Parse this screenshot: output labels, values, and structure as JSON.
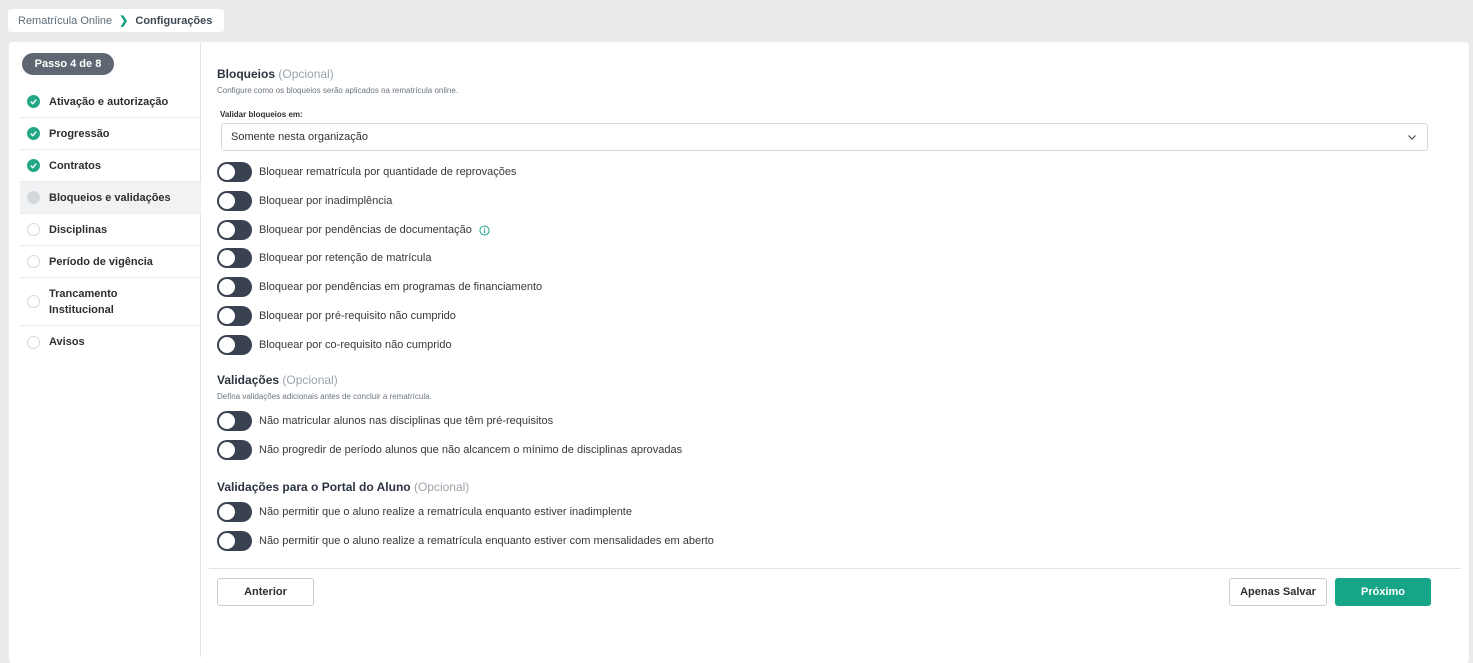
{
  "breadcrumb": {
    "parent": "Rematrícula Online",
    "current": "Configurações"
  },
  "sidebar": {
    "step_badge": "Passo 4 de 8",
    "steps": [
      {
        "label": "Ativação e autorização",
        "status": "done"
      },
      {
        "label": "Progressão",
        "status": "done"
      },
      {
        "label": "Contratos",
        "status": "done"
      },
      {
        "label": "Bloqueios e validações",
        "status": "current"
      },
      {
        "label": "Disciplinas",
        "status": "pending"
      },
      {
        "label": "Período de vigência",
        "status": "pending"
      },
      {
        "label": "Trancamento Institucional",
        "status": "pending"
      },
      {
        "label": "Avisos",
        "status": "pending"
      }
    ]
  },
  "bloqueios": {
    "title": "Bloqueios",
    "optional": "(Opcional)",
    "description": "Configure como os bloqueios serão aplicados na rematrícula online.",
    "select_label": "Validar bloqueios em:",
    "select_value": "Somente nesta organização",
    "toggles": [
      {
        "label": "Bloquear rematrícula por quantidade de reprovações",
        "on": false
      },
      {
        "label": "Bloquear por inadimplência",
        "on": false
      },
      {
        "label": "Bloquear por pendências de documentação",
        "on": false,
        "info_icon": "info-icon"
      },
      {
        "label": "Bloquear por retenção de matrícula",
        "on": false
      },
      {
        "label": "Bloquear por pendências em programas de financiamento",
        "on": false
      },
      {
        "label": "Bloquear por pré-requisito não cumprido",
        "on": false
      },
      {
        "label": "Bloquear por co-requisito não cumprido",
        "on": false
      }
    ]
  },
  "validacoes": {
    "title": "Validações",
    "optional": "(Opcional)",
    "description": "Defina validações adicionais antes de concluir a rematrícula.",
    "toggles": [
      {
        "label": "Não matricular alunos nas disciplinas que têm pré-requisitos",
        "on": false
      },
      {
        "label": "Não progredir de período alunos que não alcancem o mínimo de disciplinas aprovadas",
        "on": false
      }
    ]
  },
  "portal": {
    "title": "Validações para o Portal do Aluno",
    "optional": "(Opcional)",
    "toggles": [
      {
        "label": "Não permitir que o aluno realize a rematrícula enquanto estiver inadimplente",
        "on": false
      },
      {
        "label": "Não permitir que o aluno realize a rematrícula enquanto estiver com mensalidades em aberto",
        "on": false
      }
    ]
  },
  "footer": {
    "previous_label": "Anterior",
    "save_label": "Apenas Salvar",
    "next_label": "Próximo"
  },
  "colors": {
    "accent": "#16a587",
    "toggle_off": "#3a4150",
    "badge": "#5e6772"
  }
}
